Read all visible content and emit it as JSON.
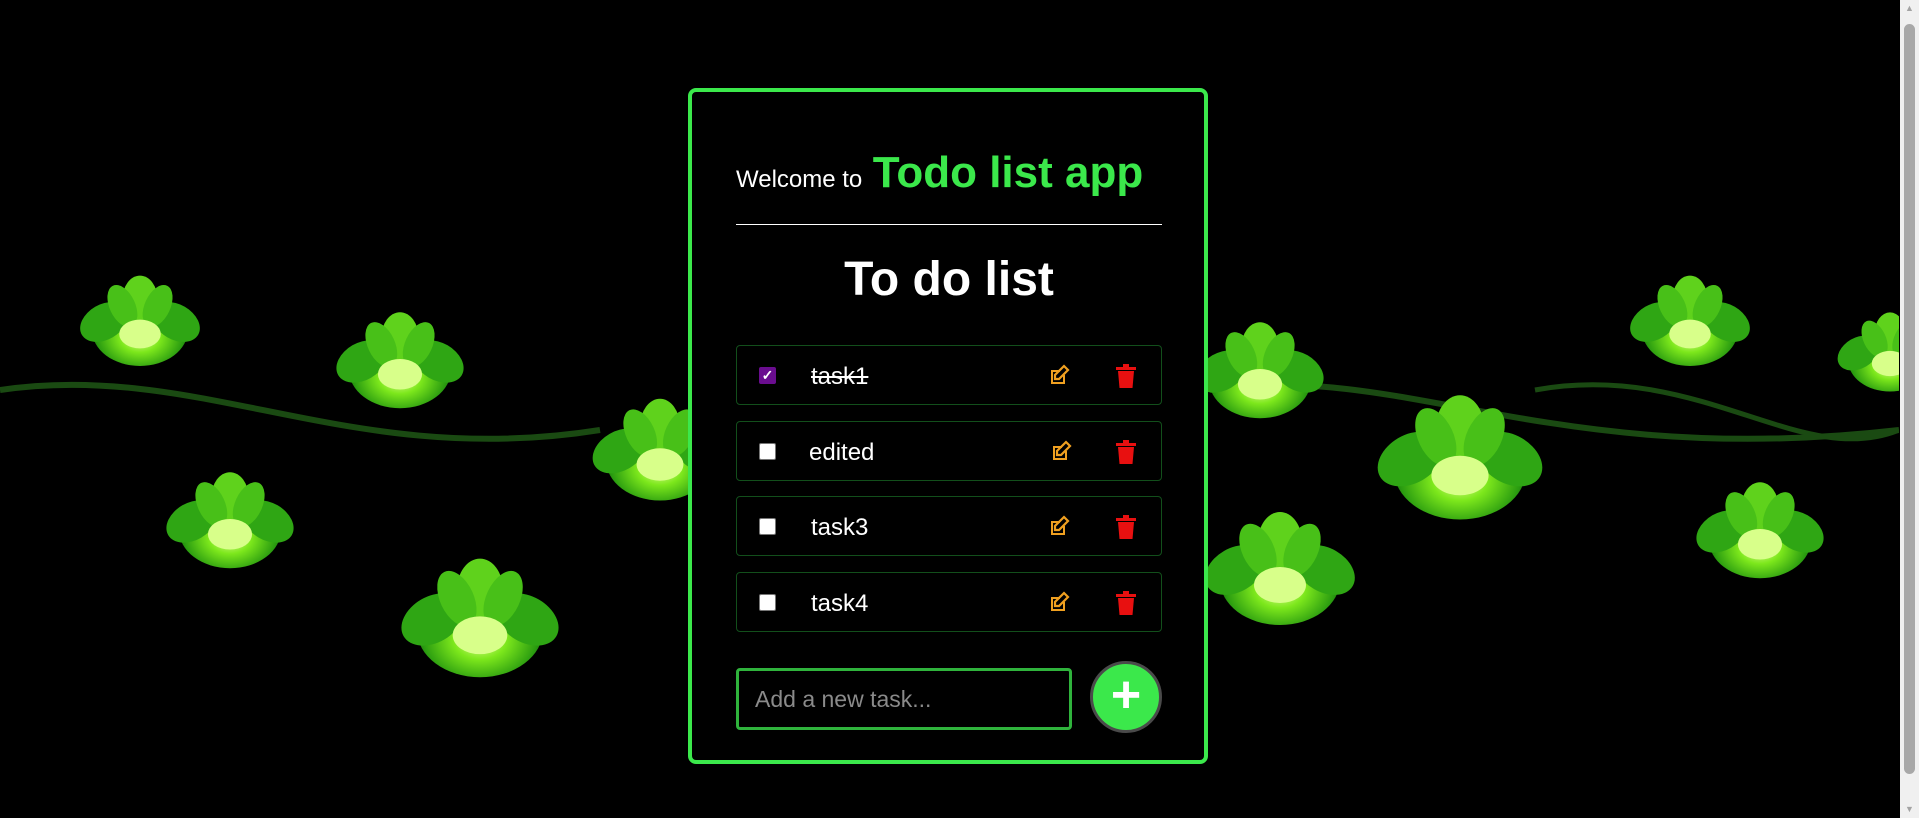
{
  "header": {
    "welcome_prefix": "Welcome to",
    "app_name": "Todo list app"
  },
  "list": {
    "title": "To do list",
    "tasks": [
      {
        "label": "task1",
        "completed": true
      },
      {
        "label": "edited",
        "completed": false
      },
      {
        "label": "task3",
        "completed": false
      },
      {
        "label": "task4",
        "completed": false
      }
    ]
  },
  "new_task": {
    "placeholder": "Add a new task...",
    "add_button_label": "+"
  },
  "icons": {
    "edit": "edit-icon",
    "delete": "trash-icon"
  },
  "colors": {
    "accent": "#3be84b",
    "edit": "#f0a020",
    "delete": "#e81010",
    "checked": "#6a0d8f"
  }
}
